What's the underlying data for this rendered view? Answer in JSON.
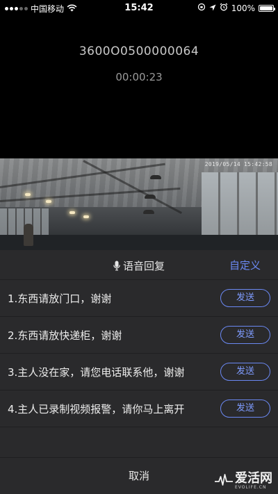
{
  "status_bar": {
    "carrier": "中国移动",
    "time": "15:42",
    "battery": "100%",
    "icons": [
      "signal-dots-icon",
      "wifi-icon",
      "orientation-lock-icon",
      "location-arrow-icon",
      "alarm-icon",
      "battery-icon"
    ]
  },
  "call": {
    "device_id": "3600O0500000064",
    "duration": "00:00:23"
  },
  "camera": {
    "timestamp": "2019/05/14 15:42:58"
  },
  "reply_sheet": {
    "title": "语音回复",
    "title_icon": "microphone-icon",
    "custom_label": "自定义",
    "send_label": "发送",
    "replies": [
      {
        "text": "1.东西请放门口，谢谢"
      },
      {
        "text": "2.东西请放快递柜，谢谢"
      },
      {
        "text": "3.主人没在家，请您电话联系他，谢谢"
      },
      {
        "text": "4.主人已录制视频报警，请你马上离开"
      }
    ],
    "cancel_label": "取消"
  },
  "watermark": {
    "name": "爱活网",
    "domain": "EVOLIFE.CN"
  },
  "colors": {
    "accent": "#6b89f4",
    "sheet_background": "#2a2a2c",
    "page_background": "#000000"
  }
}
